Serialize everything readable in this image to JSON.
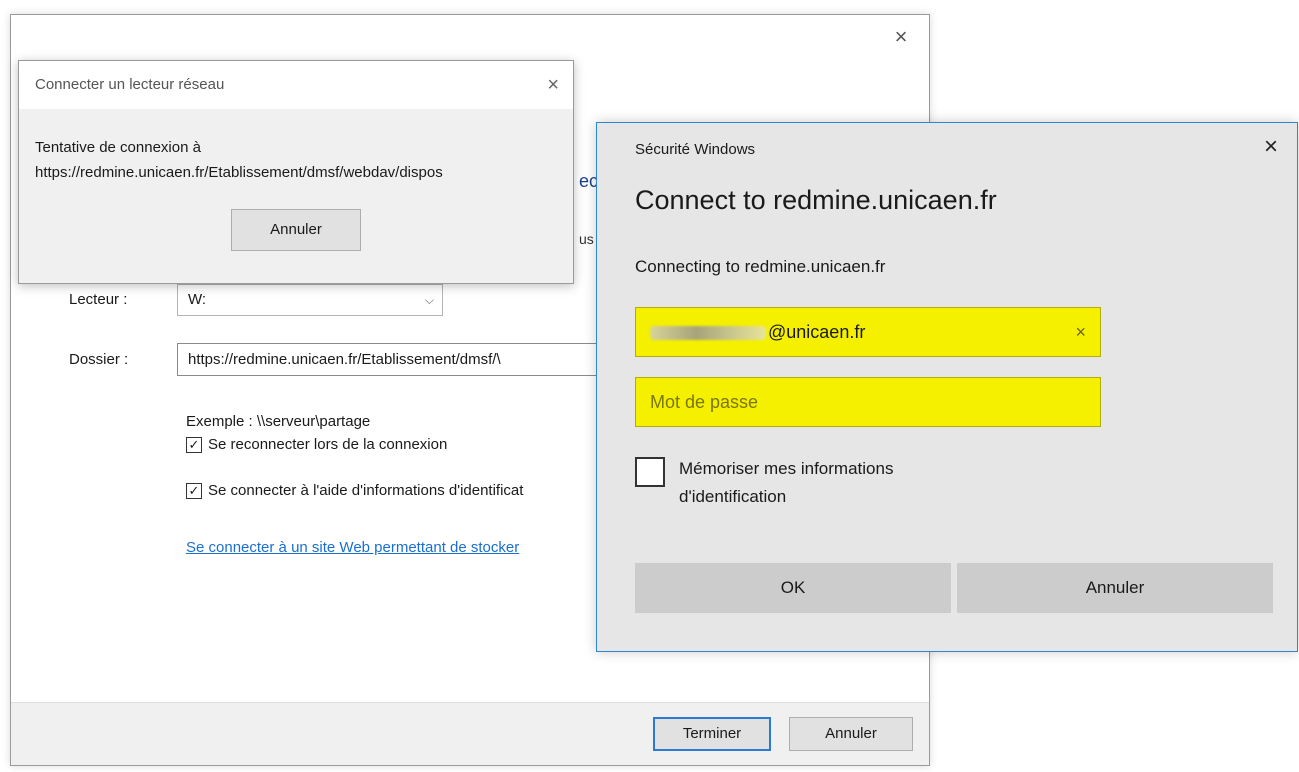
{
  "wizard": {
    "heading_fragment": "ec",
    "text_fragment": "us",
    "drive_label": "Lecteur :",
    "drive_value": "W:",
    "folder_label": "Dossier :",
    "folder_value": "https://redmine.unicaen.fr/Etablissement/dmsf/\\",
    "example": "Exemple : \\\\serveur\\partage",
    "reconnect_label": "Se reconnecter lors de la connexion",
    "credentials_label": "Se connecter à l'aide d'informations d'identificat",
    "link_text": "Se connecter à un site Web permettant de stocker",
    "finish_button": "Terminer",
    "cancel_button": "Annuler"
  },
  "progress_dialog": {
    "title": "Connecter un lecteur réseau",
    "message_line1": "Tentative de connexion à",
    "message_line2": "https://redmine.unicaen.fr/Etablissement/dmsf/webdav/dispos",
    "cancel_button": "Annuler"
  },
  "security_dialog": {
    "window_title": "Sécurité Windows",
    "heading": "Connect to redmine.unicaen.fr",
    "subheading": "Connecting to redmine.unicaen.fr",
    "username_suffix": "@unicaen.fr",
    "password_placeholder": "Mot de passe",
    "remember_label": "Mémoriser mes informations d'identification",
    "ok_button": "OK",
    "cancel_button": "Annuler",
    "field_highlight_color": "#f5f000",
    "border_color": "#2b87d1"
  },
  "icons": {
    "close": "×",
    "clear": "×",
    "chevron": "⌵",
    "check": "✓"
  }
}
